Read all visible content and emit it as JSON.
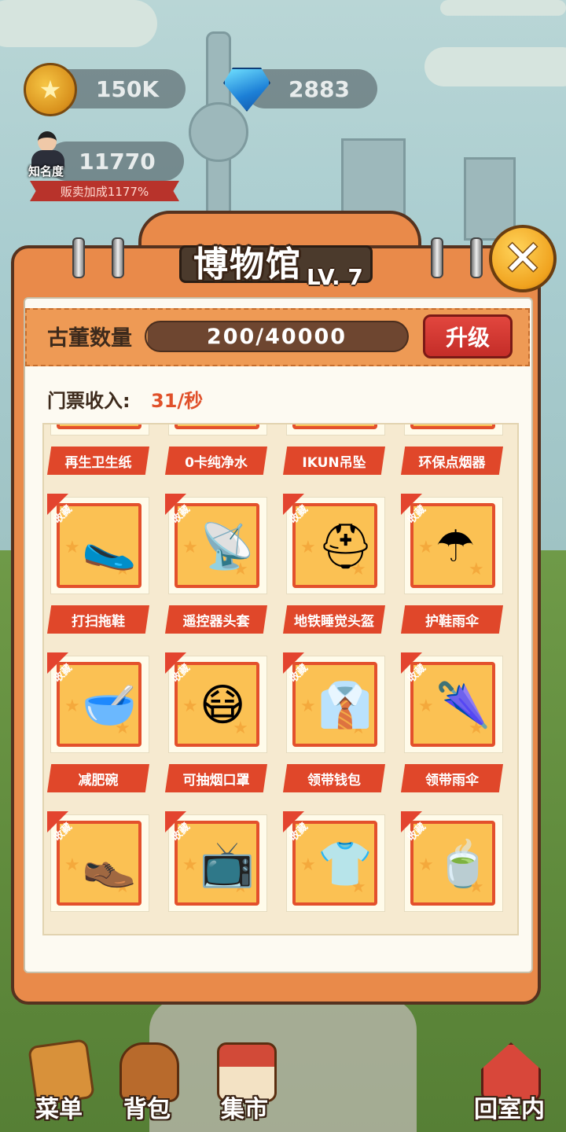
{
  "hud": {
    "coins": "150K",
    "gems": "2883",
    "fame": "11770",
    "fame_label": "知名度",
    "bonus": "贩卖加成1177%"
  },
  "museum": {
    "title": "博物馆",
    "level": "LV. 7",
    "antique_label": "古董数量",
    "antique_value": "200/40000",
    "antique_progress": 0.005,
    "upgrade_label": "升级",
    "income_label": "门票收入:",
    "income_value": "31/秒",
    "badge_text": "收藏"
  },
  "items": [
    {
      "name": "再生卫生纸",
      "icon": "tissue-icon",
      "glyph": "🧻",
      "collected": false
    },
    {
      "name": "0卡纯净水",
      "icon": "water-icon",
      "glyph": "💧",
      "collected": false
    },
    {
      "name": "IKUN吊坠",
      "icon": "pendant-icon",
      "glyph": "📿",
      "collected": false
    },
    {
      "name": "环保点烟器",
      "icon": "lighter-icon",
      "glyph": "🔥",
      "collected": false
    },
    {
      "name": "打扫拖鞋",
      "icon": "slipper-icon",
      "glyph": "🥿",
      "collected": true
    },
    {
      "name": "遥控器头套",
      "icon": "remote-headgear-icon",
      "glyph": "📡",
      "collected": true
    },
    {
      "name": "地铁睡觉头盔",
      "icon": "helmet-icon",
      "glyph": "⛑",
      "collected": true
    },
    {
      "name": "护鞋雨伞",
      "icon": "shoe-umbrella-icon",
      "glyph": "☂",
      "collected": true
    },
    {
      "name": "减肥碗",
      "icon": "bowl-icon",
      "glyph": "🥣",
      "collected": true
    },
    {
      "name": "可抽烟口罩",
      "icon": "mask-icon",
      "glyph": "😷",
      "collected": true
    },
    {
      "name": "领带钱包",
      "icon": "tie-wallet-icon",
      "glyph": "👔",
      "collected": true
    },
    {
      "name": "领带雨伞",
      "icon": "tie-umbrella-icon",
      "glyph": "🌂",
      "collected": true
    },
    {
      "name": "",
      "icon": "shoe-icon",
      "glyph": "👞",
      "collected": true
    },
    {
      "name": "",
      "icon": "spiked-device-icon",
      "glyph": "📺",
      "collected": true
    },
    {
      "name": "",
      "icon": "shirt-icon",
      "glyph": "👕",
      "collected": true
    },
    {
      "name": "",
      "icon": "cups-icon",
      "glyph": "🍵",
      "collected": true
    }
  ],
  "nav": {
    "menu": "菜单",
    "bag": "背包",
    "market": "集市",
    "home": "回室内"
  },
  "colors": {
    "panel": "#e98a4a",
    "accent_red": "#e0472a",
    "income": "#e0502a"
  }
}
